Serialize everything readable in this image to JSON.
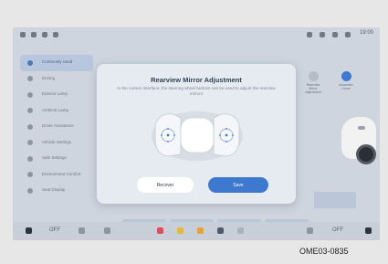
{
  "screen": {
    "statusbar": {
      "time": "19:00"
    },
    "sidebar": {
      "items": [
        {
          "label": "Commonly Used",
          "active": true
        },
        {
          "label": "Driving",
          "active": false
        },
        {
          "label": "Exterior Lamp",
          "active": false
        },
        {
          "label": "Ambient Lamp",
          "active": false
        },
        {
          "label": "Driver Assistance",
          "active": false
        },
        {
          "label": "Vehicle Settings",
          "active": false
        },
        {
          "label": "Safe Settings",
          "active": false
        },
        {
          "label": "Environment Comfort",
          "active": false
        },
        {
          "label": "Seat Display",
          "active": false
        }
      ]
    },
    "right_panel": {
      "items": [
        {
          "label": "Rearview Mirror Adjustment"
        },
        {
          "label": "Automatic Home"
        }
      ]
    },
    "dock": {
      "left_label": "OFF",
      "right_label": "OFF"
    }
  },
  "modal": {
    "title": "Rearview Mirror Adjustment",
    "description": "In the current interface, the steering wheel buttons can be used to adjust the rearview mirrors",
    "recover_label": "Recover",
    "save_label": "Save"
  },
  "caption": "OME03-0835",
  "colors": {
    "accent": "#3e78cf",
    "modal_bg": "#e6ebf1",
    "screen_bg": "#ced5de"
  }
}
